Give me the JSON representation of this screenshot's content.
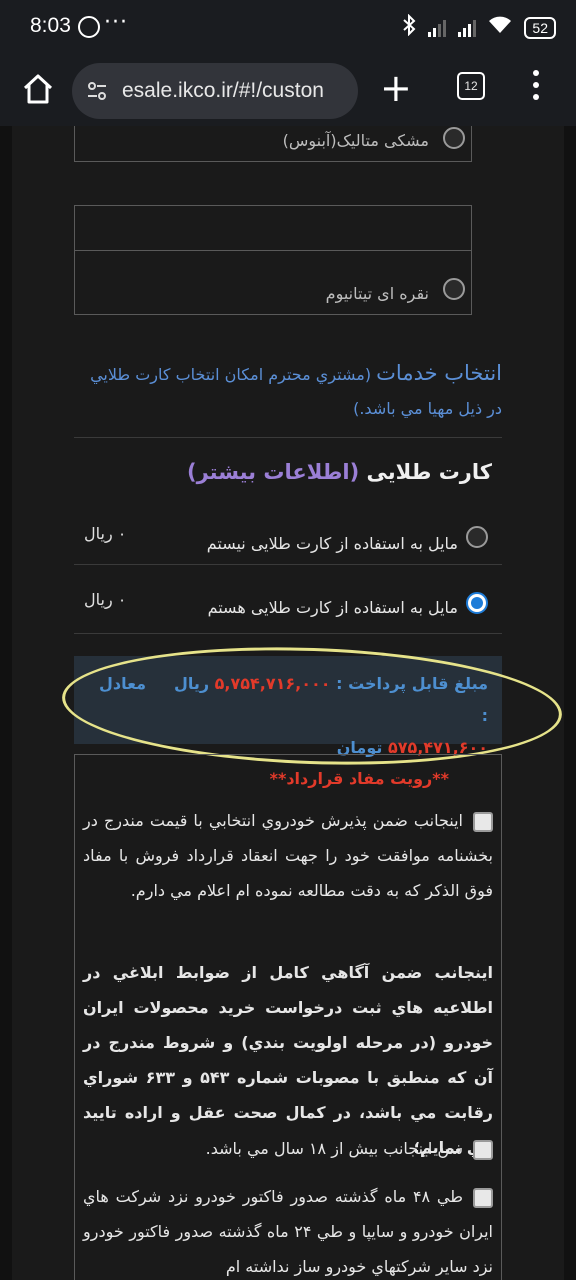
{
  "status": {
    "time": "8:03",
    "dots": "···",
    "battery": "52"
  },
  "browser": {
    "url": "esale.ikco.ir/#!/custon",
    "tab_count": "12"
  },
  "colors": {
    "options": [
      {
        "label": "مشکی متالیک(آبنوس)",
        "selected": false
      },
      {
        "label": "نقره ای تیتانیوم",
        "selected": false
      }
    ]
  },
  "services": {
    "title": "انتخاب خدمات",
    "note": "(مشتري محترم امکان انتخاب کارت طلايي در ذيل مهيا مي باشد.)"
  },
  "gold_card": {
    "title": "کارت طلایی",
    "more_info": "(اطلاعات بیشتر)",
    "options": [
      {
        "label": "مایل به استفاده از کارت طلایی نیستم",
        "price": "۰ ریال",
        "selected": false
      },
      {
        "label": "مایل به استفاده از کارت طلایی هستم",
        "price": "۰ ریال",
        "selected": true
      }
    ]
  },
  "payment": {
    "label": "مبلغ قابل پرداخت :",
    "amount_rial": "۵,۷۵۴,۷۱۶,۰۰۰",
    "rial_unit": "ریال",
    "equiv_label": "معادل :",
    "amount_toman": "۵۷۵,۴۷۱,۶۰۰",
    "toman_unit": "تومان"
  },
  "contract": {
    "title": "**رویت مفاد قرارداد**",
    "p1": "اينجانب ضمن پذيرش خودروي انتخابي با قيمت مندرج در بخشنامه موافقت خود را جهت انعقاد قرارداد فروش با مفاد فوق الذکر که به دقت مطالعه نموده ام اعلام مي دارم.",
    "p2": "اینجانب ضمن آگاهي کامل از ضوابط ابلاغي در اطلاعيه هاي ثبت درخواست خريد محصولات ايران خودرو (در مرحله اولويت بندي) و شروط مندرج در آن که منطبق با مصوبات شماره ۵۴۳ و ۶۳۳ شوراي رقابت مي باشد، در کمال صحت عقل و اراده تاييد مي نمايم؛",
    "p3": "سن اينجانب بيش از ۱۸ سال مي باشد.",
    "p4": "طي ۴۸ ماه گذشته صدور فاکتور خودرو نزد شرکت هاي ايران خودرو و سايپا و طي ۲۴ ماه گذشته صدور فاکتور خودرو نزد ساير شرکتهاي خودرو ساز نداشته ام"
  }
}
